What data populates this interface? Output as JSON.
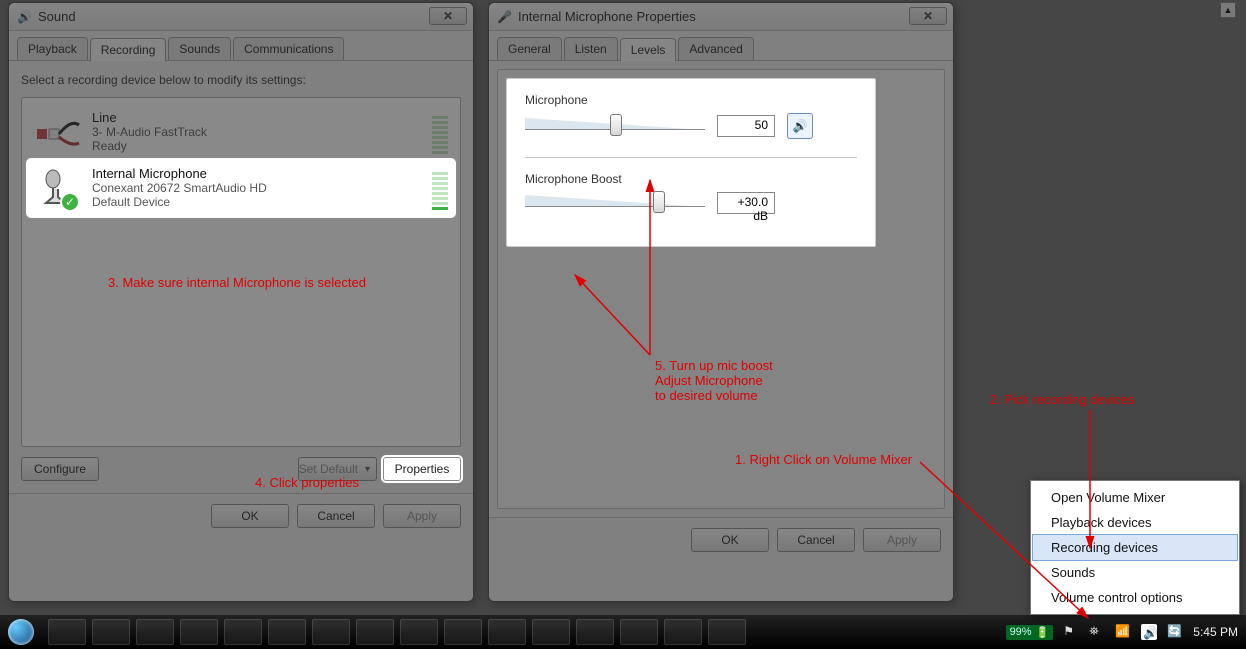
{
  "sound_window": {
    "title": "Sound",
    "tabs": [
      "Playback",
      "Recording",
      "Sounds",
      "Communications"
    ],
    "active_tab": 1,
    "prompt": "Select a recording device below to modify its settings:",
    "devices": [
      {
        "name": "Line",
        "desc": "3- M-Audio FastTrack",
        "status": "Ready",
        "selected": false
      },
      {
        "name": "Internal Microphone",
        "desc": "Conexant 20672 SmartAudio HD",
        "status": "Default Device",
        "selected": true
      }
    ],
    "buttons": {
      "configure": "Configure",
      "set_default": "Set Default",
      "properties": "Properties"
    },
    "footer": {
      "ok": "OK",
      "cancel": "Cancel",
      "apply": "Apply"
    }
  },
  "props_window": {
    "title": "Internal Microphone Properties",
    "tabs": [
      "General",
      "Listen",
      "Levels",
      "Advanced"
    ],
    "active_tab": 2,
    "levels": {
      "mic_label": "Microphone",
      "mic_value": "50",
      "mic_pos_pct": 50,
      "boost_label": "Microphone Boost",
      "boost_value": "+30.0 dB",
      "boost_pos_pct": 75
    },
    "footer": {
      "ok": "OK",
      "cancel": "Cancel",
      "apply": "Apply"
    }
  },
  "context_menu": {
    "items": [
      "Open Volume Mixer",
      "Playback devices",
      "Recording devices",
      "Sounds",
      "Volume control options"
    ],
    "highlight_index": 2
  },
  "taskbar": {
    "battery": "99%",
    "clock": "5:45 PM"
  },
  "annotations": {
    "a1": "1. Right Click on Volume Mixer",
    "a2": "2. Pick recording devices",
    "a3": "3. Make sure internal Microphone is selected",
    "a4": "4. Click properties",
    "a5": "5. Turn up mic boost\nAdjust Microphone\nto desired volume"
  }
}
